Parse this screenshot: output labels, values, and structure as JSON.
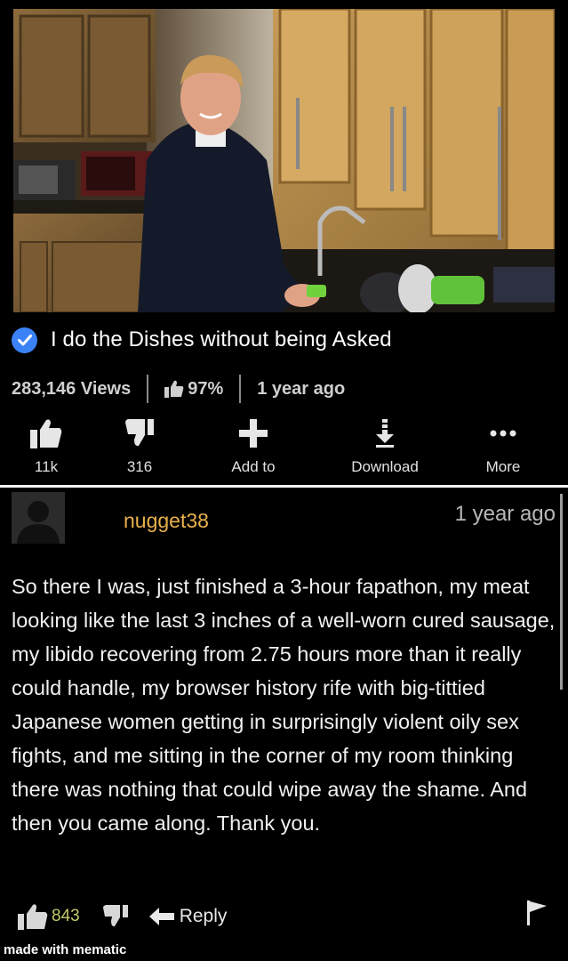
{
  "video": {
    "title": "I do the Dishes without being Asked",
    "views": "283,146 Views",
    "rating": "97%",
    "age": "1 year ago"
  },
  "actions": {
    "like_count": "11k",
    "dislike_count": "316",
    "add_label": "Add to",
    "download_label": "Download",
    "more_label": "More"
  },
  "comment": {
    "username": "nugget38",
    "timestamp": "1 year ago",
    "body": "So there I was, just finished a 3-hour fapathon, my meat looking like the last 3 inches of a well-worn cured sausage, my libido recovering from 2.75 hours more than it really could handle, my browser history rife with big-tittied Japanese women getting in surprisingly violent oily sex fights, and me sitting in the corner of my room thinking there was nothing that could wipe away the shame. And then you came along. Thank you.",
    "likes": "843",
    "reply_label": "Reply"
  },
  "watermark": "made with mematic",
  "colors": {
    "verified": "#3b82f6",
    "username": "#e8b04b",
    "likes": "#c4c86a"
  }
}
